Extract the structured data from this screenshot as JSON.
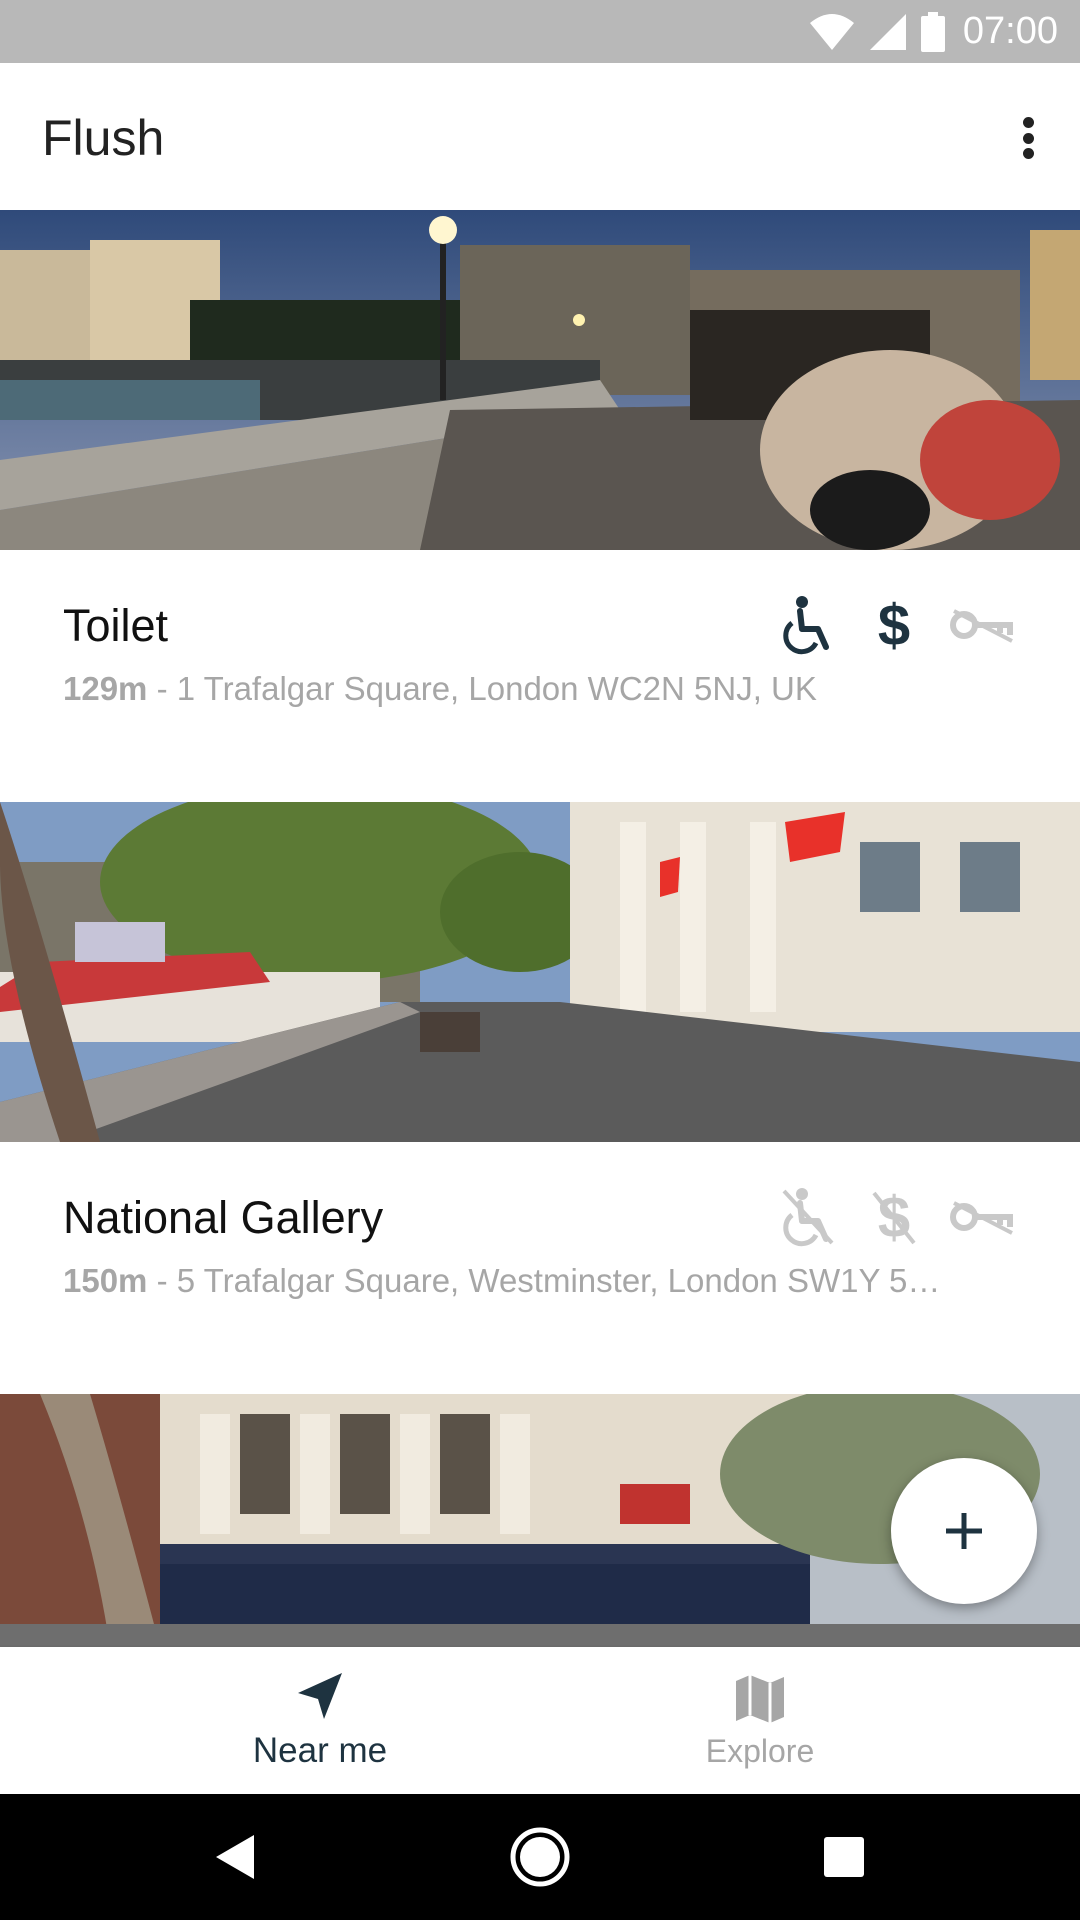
{
  "status_bar": {
    "time": "07:00",
    "icons": [
      "wifi-icon",
      "signal-icon",
      "battery-icon"
    ]
  },
  "app_bar": {
    "title": "Flush",
    "menu_icon": "more-vert-icon"
  },
  "cards": [
    {
      "title": "Toilet",
      "distance": "129m",
      "address": " - 1 Trafalgar Square, London WC2N 5NJ, UK",
      "amenities": {
        "accessible": true,
        "paid": true,
        "key_required": false
      }
    },
    {
      "title": "National Gallery",
      "distance": "150m",
      "address": " - 5 Trafalgar Square, Westminster, London SW1Y 5…",
      "amenities": {
        "accessible": false,
        "paid": false,
        "key_required": false
      }
    }
  ],
  "fab": {
    "icon": "plus-icon"
  },
  "bottom_nav": {
    "near_me": {
      "label": "Near me",
      "icon": "navigation-arrow-icon",
      "active": true
    },
    "explore": {
      "label": "Explore",
      "icon": "map-icon",
      "active": false
    }
  },
  "system_nav": {
    "icons": [
      "back-icon",
      "home-icon",
      "recents-icon"
    ]
  },
  "colors": {
    "active": "#1e3340",
    "inactive": "#a6a6a6",
    "status_bar": "#b8b8b8"
  }
}
